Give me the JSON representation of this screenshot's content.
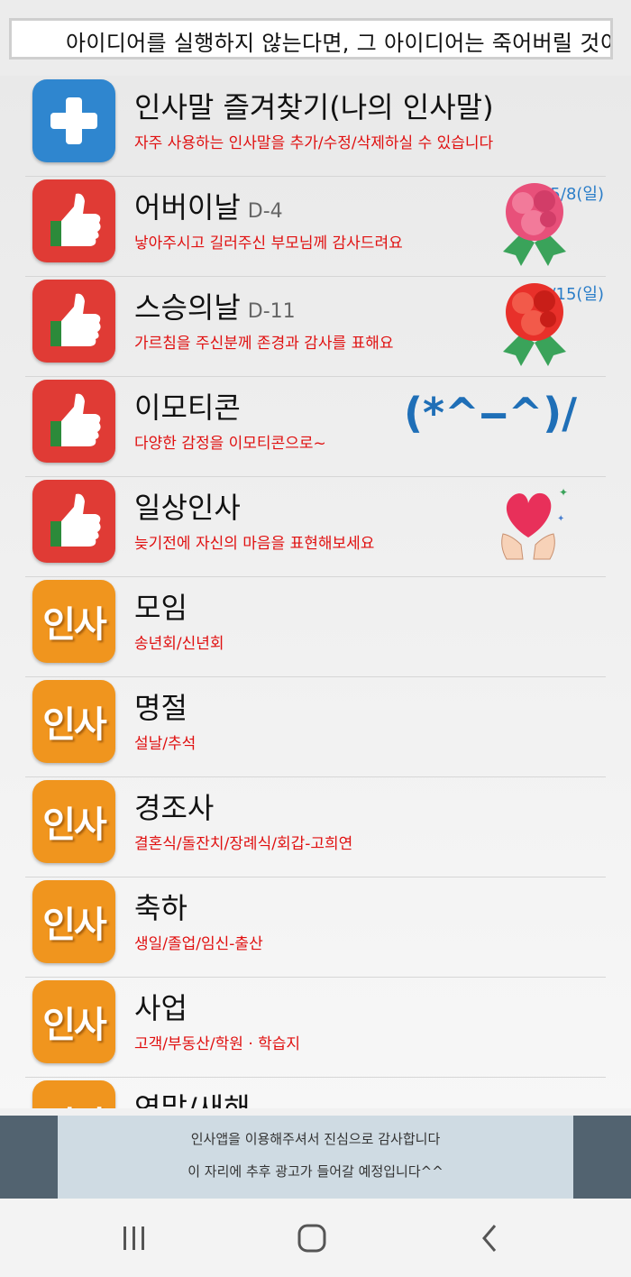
{
  "ticker": {
    "text": "아이디어를 실행하지 않는다면, 그 아이디어는 죽어버릴 것이다"
  },
  "items": [
    {
      "title": "인사말 즐겨찾기(나의 인사말)",
      "subtitle": "자주 사용하는 인사말을 추가/수정/삭제하실 수 있습니다",
      "icon": "plus-icon"
    },
    {
      "title": "어버이날",
      "dday": "D-4",
      "subtitle": "낳아주시고 길러주신 부모님께 감사드려요",
      "date": "5/8(일)",
      "icon": "thumbs-up-icon"
    },
    {
      "title": "스승의날",
      "dday": "D-11",
      "subtitle": "가르침을 주신분께 존경과 감사를 표해요",
      "date": "5/15(일)",
      "icon": "thumbs-up-icon"
    },
    {
      "title": "이모티콘",
      "subtitle": "다양한 감정을 이모티콘으로~",
      "emoticon": "(*^‒^)/",
      "icon": "thumbs-up-icon"
    },
    {
      "title": "일상인사",
      "subtitle": "늦기전에 자신의 마음을 표현해보세요",
      "icon": "thumbs-up-icon"
    },
    {
      "title": "모임",
      "subtitle": "송년회/신년회",
      "badge": "인사"
    },
    {
      "title": "명절",
      "subtitle": "설날/추석",
      "badge": "인사"
    },
    {
      "title": "경조사",
      "subtitle": "결혼식/돌잔치/장례식/회갑-고희연",
      "badge": "인사"
    },
    {
      "title": "축하",
      "subtitle": "생일/졸업/임신-출산",
      "badge": "인사"
    },
    {
      "title": "사업",
      "subtitle": "고객/부동산/학원 · 학습지",
      "badge": "인사"
    },
    {
      "title": "연말/새해",
      "subtitle": "",
      "badge": "인사"
    }
  ],
  "ad": {
    "line1": "인사앱을 이용해주셔서 진심으로 감사합니다",
    "line2": "이 자리에 추후 광고가 들어갈 예정입니다^^"
  },
  "colors": {
    "blue_icon": "#2f86cf",
    "red_icon": "#e03b35",
    "orange_icon": "#f0951e",
    "subtitle_red": "#e01010",
    "date_blue": "#2a7dc8"
  },
  "nav": [
    "recent-apps-icon",
    "home-icon",
    "back-icon"
  ]
}
